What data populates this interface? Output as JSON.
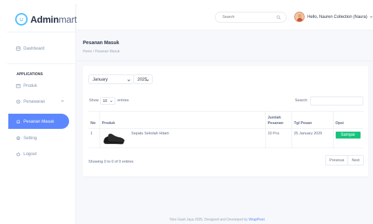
{
  "brand": {
    "bold": "Admin",
    "light": "mart"
  },
  "sidebar": {
    "dashboard": "Dashboard",
    "section_label": "APPLICATIONS",
    "items": [
      {
        "label": "Produk"
      },
      {
        "label": "Penawaran"
      },
      {
        "label": "Pesanan Masuk"
      },
      {
        "label": "Setting"
      },
      {
        "label": "Logout"
      }
    ]
  },
  "topbar": {
    "search_placeholder": "Search",
    "user_name": "Hello, Nauren Collection (Naura)"
  },
  "page": {
    "title": "Pesanan Masuk",
    "breadcrumb": "Home  /  Pesanan Masuk"
  },
  "filters": {
    "month": "January",
    "year": "2025"
  },
  "table_controls": {
    "show_label": "Show",
    "entries_value": "10",
    "entries_label": "entries",
    "search_label": "Search:"
  },
  "table": {
    "headers": [
      "No",
      "Produk",
      "Jumlah Pesanan",
      "Tgl Pesan",
      "Opsi"
    ],
    "rows": [
      {
        "no": "1",
        "product": "Sepatu Sekolah Hitam",
        "qty": "10 Pcs",
        "date": "25 January 2025",
        "action": "Sampai"
      }
    ]
  },
  "table_info": "Showing 0 to 0 of 0 entries",
  "pagination": {
    "previous": "Previous",
    "next": "Next"
  },
  "footer": {
    "text": "Toko Gasti Jaya 2025. Designed and Developed by ",
    "link": "WrapPixel"
  },
  "colors": {
    "primary": "#5d87ff",
    "success": "#19c37d",
    "text": "#2a3547"
  }
}
